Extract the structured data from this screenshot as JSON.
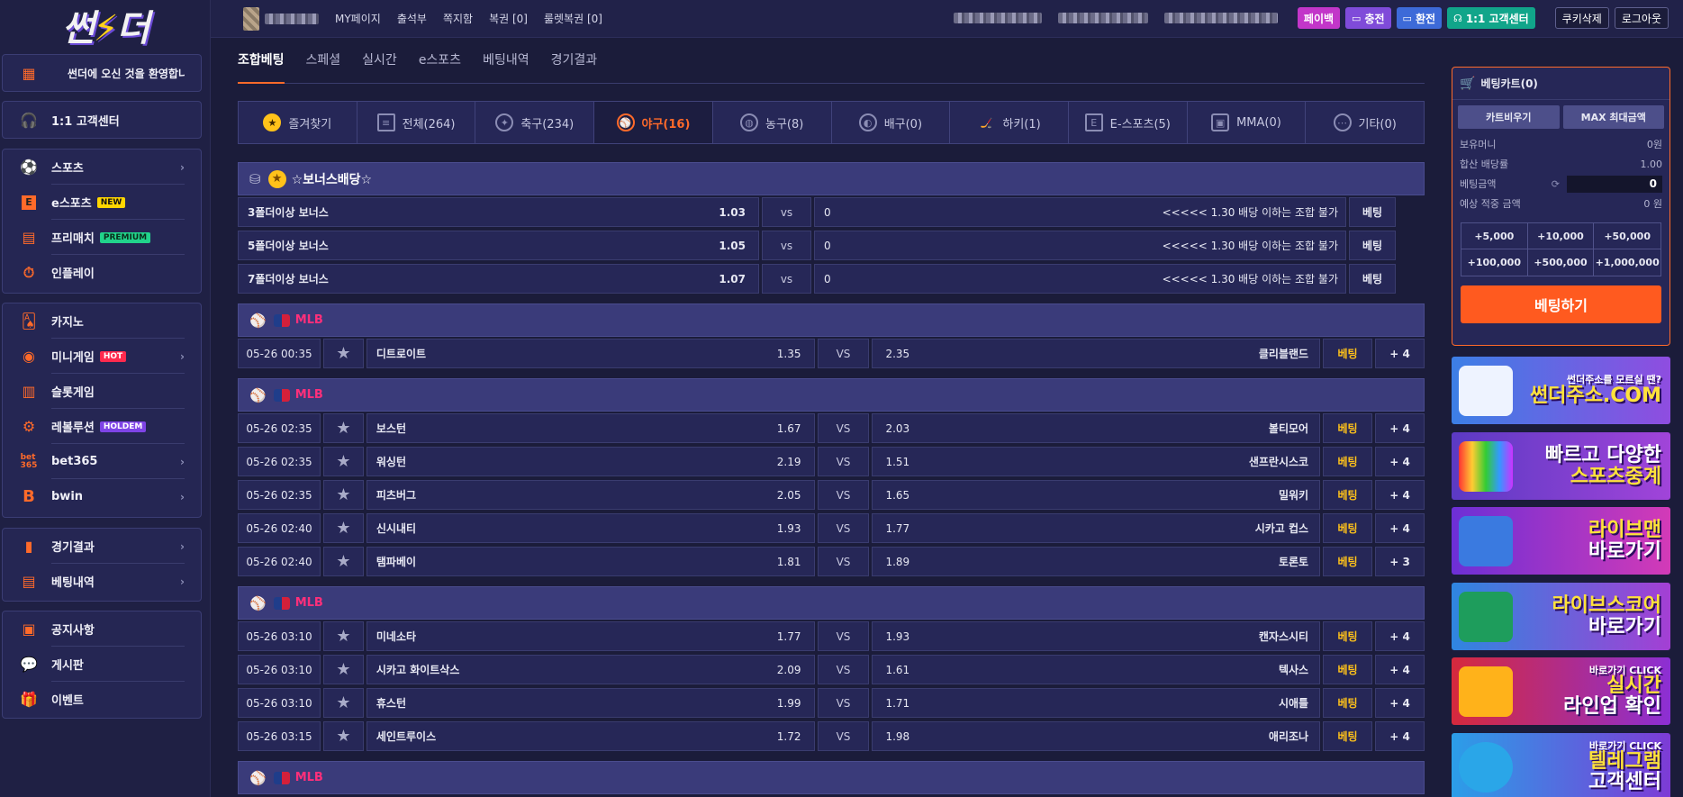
{
  "logo": {
    "text_a": "썬",
    "text_b": "더"
  },
  "sidebar": {
    "welcome": "썬더에 오신 것을 환영합니",
    "cs": "1:1 고객센터",
    "group1": [
      {
        "label": "스포츠",
        "icon": "soccer-ball-icon",
        "arrow": "›"
      },
      {
        "label": "e스포츠",
        "icon": "e-letter-icon",
        "badge": "NEW"
      },
      {
        "label": "프리매치",
        "icon": "ticket-icon",
        "badge": "PREMIUM"
      },
      {
        "label": "인플레이",
        "icon": "stopwatch-icon"
      }
    ],
    "group2": [
      {
        "label": "카지노",
        "icon": "cards-icon"
      },
      {
        "label": "미니게임",
        "icon": "coin-icon",
        "badge": "HOT",
        "arrow": "›"
      },
      {
        "label": "슬롯게임",
        "icon": "slot-icon"
      },
      {
        "label": "레볼루션",
        "icon": "chip-icon",
        "badge": "HOLDEM"
      },
      {
        "label": "bet365",
        "icon": "bet365-icon",
        "arrow": "›"
      },
      {
        "label": "bwin",
        "icon": "bwin-icon",
        "arrow": "›"
      }
    ],
    "group3": [
      {
        "label": "경기결과",
        "icon": "bar-chart-icon",
        "arrow": "›"
      },
      {
        "label": "베팅내역",
        "icon": "receipt-icon",
        "arrow": "›"
      }
    ],
    "group4": [
      {
        "label": "공지사항",
        "icon": "notice-icon"
      },
      {
        "label": "게시판",
        "icon": "chat-icon"
      },
      {
        "label": "이벤트",
        "icon": "gift-icon"
      }
    ]
  },
  "header": {
    "nav": [
      "MY페이지",
      "출석부",
      "쪽지함",
      "복권 [0]",
      "룰렛복권 [0]"
    ],
    "buttons": {
      "payback": "페이백",
      "charge": "충전",
      "exchange": "환전",
      "cs": "1:1 고객센터",
      "cookie": "쿠키삭제",
      "logout": "로그아웃"
    }
  },
  "tabs": [
    {
      "label": "조합베팅",
      "active": true
    },
    {
      "label": "스페셜"
    },
    {
      "label": "실시간"
    },
    {
      "label": "e스포츠"
    },
    {
      "label": "베팅내역"
    },
    {
      "label": "경기결과"
    }
  ],
  "sports": [
    {
      "label": "즐겨찾기",
      "icon": "star-icon"
    },
    {
      "label": "전체(264)",
      "icon": "list-icon"
    },
    {
      "label": "축구(234)",
      "icon": "soccer-icon"
    },
    {
      "label": "야구(16)",
      "icon": "baseball-icon",
      "active": true
    },
    {
      "label": "농구(8)",
      "icon": "basketball-icon"
    },
    {
      "label": "배구(0)",
      "icon": "volleyball-icon"
    },
    {
      "label": "하키(1)",
      "icon": "hockey-icon"
    },
    {
      "label": "E-스포츠(5)",
      "icon": "esports-icon"
    },
    {
      "label": "MMA(0)",
      "icon": "mma-icon"
    },
    {
      "label": "기타(0)",
      "icon": "more-icon"
    }
  ],
  "bonus": {
    "title": "☆보너스배당☆",
    "rows": [
      {
        "name": "3폴더이상 보너스",
        "odds": "1.03",
        "vs": "vs",
        "zero": "0",
        "note": "<<<<< 1.30 배당 이하는 조합 불가",
        "btn": "베팅"
      },
      {
        "name": "5폴더이상 보너스",
        "odds": "1.05",
        "vs": "vs",
        "zero": "0",
        "note": "<<<<< 1.30 배당 이하는 조합 불가",
        "btn": "베팅"
      },
      {
        "name": "7폴더이상 보너스",
        "odds": "1.07",
        "vs": "vs",
        "zero": "0",
        "note": "<<<<< 1.30 배당 이하는 조합 불가",
        "btn": "베팅"
      }
    ]
  },
  "leagues": [
    {
      "name": "MLB",
      "games": [
        {
          "time": "05-26 00:35",
          "home": "디트로이트",
          "home_odds": "1.35",
          "vs": "VS",
          "away_odds": "2.35",
          "away": "클리블랜드",
          "bet": "베팅",
          "more": "+ 4"
        }
      ]
    },
    {
      "name": "MLB",
      "games": [
        {
          "time": "05-26 02:35",
          "home": "보스턴",
          "home_odds": "1.67",
          "vs": "VS",
          "away_odds": "2.03",
          "away": "볼티모어",
          "bet": "베팅",
          "more": "+ 4"
        },
        {
          "time": "05-26 02:35",
          "home": "워싱턴",
          "home_odds": "2.19",
          "vs": "VS",
          "away_odds": "1.51",
          "away": "샌프란시스코",
          "bet": "베팅",
          "more": "+ 4"
        },
        {
          "time": "05-26 02:35",
          "home": "피츠버그",
          "home_odds": "2.05",
          "vs": "VS",
          "away_odds": "1.65",
          "away": "밀워키",
          "bet": "베팅",
          "more": "+ 4"
        },
        {
          "time": "05-26 02:40",
          "home": "신시내티",
          "home_odds": "1.93",
          "vs": "VS",
          "away_odds": "1.77",
          "away": "시카고 컵스",
          "bet": "베팅",
          "more": "+ 4"
        },
        {
          "time": "05-26 02:40",
          "home": "탬파베이",
          "home_odds": "1.81",
          "vs": "VS",
          "away_odds": "1.89",
          "away": "토론토",
          "bet": "베팅",
          "more": "+ 3"
        }
      ]
    },
    {
      "name": "MLB",
      "games": [
        {
          "time": "05-26 03:10",
          "home": "미네소타",
          "home_odds": "1.77",
          "vs": "VS",
          "away_odds": "1.93",
          "away": "캔자스시티",
          "bet": "베팅",
          "more": "+ 4"
        },
        {
          "time": "05-26 03:10",
          "home": "시카고 화이트삭스",
          "home_odds": "2.09",
          "vs": "VS",
          "away_odds": "1.61",
          "away": "텍사스",
          "bet": "베팅",
          "more": "+ 4"
        },
        {
          "time": "05-26 03:10",
          "home": "휴스턴",
          "home_odds": "1.99",
          "vs": "VS",
          "away_odds": "1.71",
          "away": "시애틀",
          "bet": "베팅",
          "more": "+ 4"
        },
        {
          "time": "05-26 03:15",
          "home": "세인트루이스",
          "home_odds": "1.72",
          "vs": "VS",
          "away_odds": "1.98",
          "away": "애리조나",
          "bet": "베팅",
          "more": "+ 4"
        }
      ]
    },
    {
      "name": "MLB",
      "games": []
    }
  ],
  "cart": {
    "title": "베팅카트(0)",
    "clear": "카트비우기",
    "max": "MAX 최대금액",
    "balance_label": "보유머니",
    "balance": "0원",
    "odds_label": "합산 배당률",
    "odds": "1.00",
    "amount_label": "베팅금액",
    "amount": "0",
    "expect_label": "예상 적중 금액",
    "expect": "0 원",
    "quick": [
      "+5,000",
      "+10,000",
      "+50,000",
      "+100,000",
      "+500,000",
      "+1,000,000"
    ],
    "place": "베팅하기"
  },
  "banners": [
    {
      "small": "썬더주소를 모르실 땐?",
      "l1": "썬더주소.COM"
    },
    {
      "l1": "빠르고 다양한",
      "l2": "스포츠중계"
    },
    {
      "l1": "라이브맨",
      "l2": "바로가기"
    },
    {
      "l1": "라이브스코어",
      "l2": "바로가기"
    },
    {
      "small": "바로가기 CLICK",
      "l1": "실시간",
      "l2": "라인업 확인"
    },
    {
      "small": "바로가기 CLICK",
      "l1": "텔레그램",
      "l2": "고객센터"
    }
  ],
  "colors": {
    "accent": "#ff6a2a",
    "bg": "#1b1c3a",
    "panel": "#262757",
    "league_bar": "#3a3b7a",
    "bet_yellow": "#ffc21a",
    "league_pink": "#ff2f7a"
  }
}
